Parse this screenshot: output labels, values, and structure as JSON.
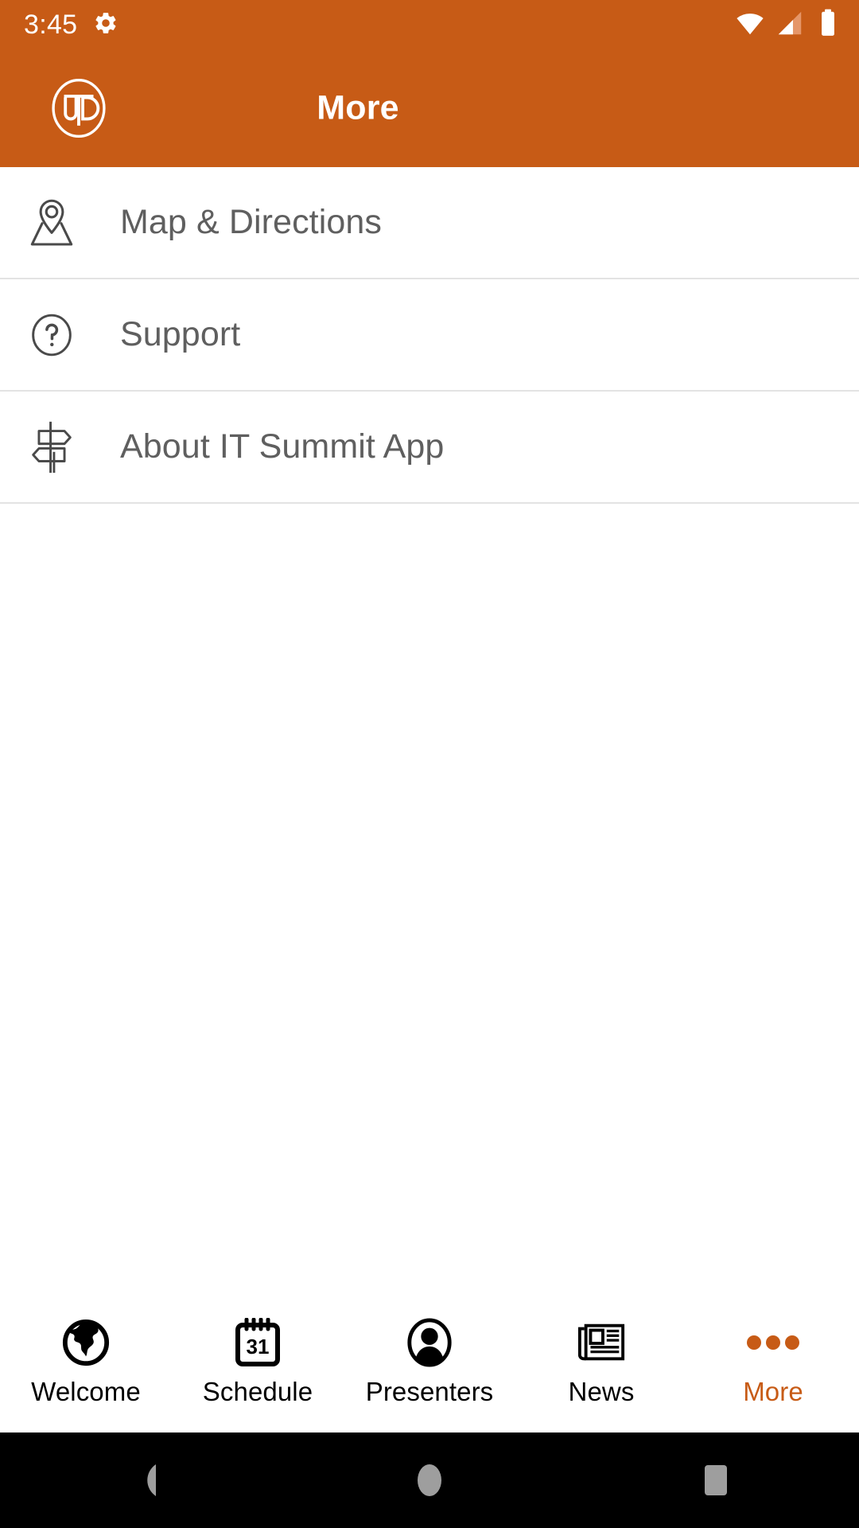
{
  "theme": {
    "brand_color": "#C75B16",
    "appbar_text_color": "#FFFFFF",
    "list_text_color": "#5F5F5F",
    "divider_color": "#E3E3E3",
    "tab_inactive_color": "#000000",
    "tab_active_color": "#C75B16",
    "navbar_background": "#000000",
    "navbar_icon_color": "#9E9E9E"
  },
  "status_bar": {
    "time": "3:45",
    "icons": [
      "gear-icon",
      "wifi-icon",
      "cellular-signal-icon",
      "battery-icon"
    ]
  },
  "app_bar": {
    "logo": "utd-logo",
    "title": "More"
  },
  "list": {
    "items": [
      {
        "label": "Map & Directions",
        "icon": "map-pin-icon"
      },
      {
        "label": "Support",
        "icon": "question-circle-icon"
      },
      {
        "label": "About IT Summit App",
        "icon": "signpost-icon"
      }
    ]
  },
  "tab_bar": {
    "active_index": 4,
    "tabs": [
      {
        "label": "Welcome",
        "icon": "globe-icon"
      },
      {
        "label": "Schedule",
        "icon": "calendar-icon",
        "calendar_day": "31"
      },
      {
        "label": "Presenters",
        "icon": "person-circle-icon"
      },
      {
        "label": "News",
        "icon": "newspaper-icon"
      },
      {
        "label": "More",
        "icon": "ellipsis-icon"
      }
    ]
  },
  "navigation_bar": {
    "buttons": [
      {
        "name": "back-button",
        "icon": "triangle-left-icon"
      },
      {
        "name": "home-button",
        "icon": "circle-icon"
      },
      {
        "name": "recents-button",
        "icon": "square-icon"
      }
    ]
  }
}
